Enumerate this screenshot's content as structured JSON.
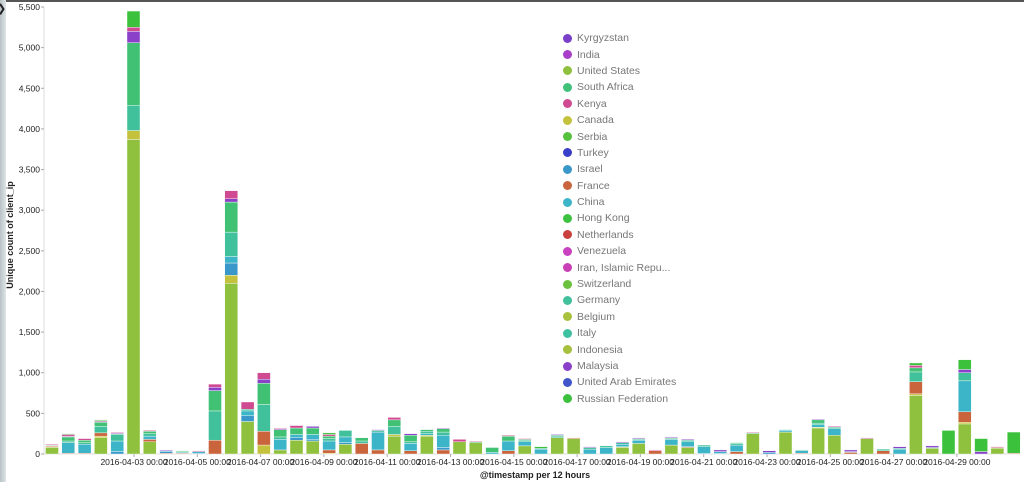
{
  "chart_data": {
    "type": "bar",
    "stacked": true,
    "xlabel": "@timestamp per 12 hours",
    "ylabel": "Unique count of client_ip",
    "ylim": [
      0,
      5500
    ],
    "yticks": [
      "0",
      "500",
      "1,000",
      "1,500",
      "2,000",
      "2,500",
      "3,000",
      "3,500",
      "4,000",
      "4,500",
      "5,000",
      "5,500"
    ],
    "xticks": [
      "2016-04-03 00:00",
      "2016-04-05 00:00",
      "2016-04-07 00:00",
      "2016-04-09 00:00",
      "2016-04-11 00:00",
      "2016-04-13 00:00",
      "2016-04-15 00:00",
      "2016-04-17 00:00",
      "2016-04-19 00:00",
      "2016-04-21 00:00",
      "2016-04-23 00:00",
      "2016-04-25 00:00",
      "2016-04-27 00:00",
      "2016-04-29 00:00"
    ],
    "x": [
      "2016-04-01 12:00",
      "2016-04-02 00:00",
      "2016-04-02 12:00",
      "2016-04-03 00:00",
      "2016-04-03 12:00",
      "2016-04-04 00:00",
      "2016-04-04 12:00",
      "2016-04-05 00:00",
      "2016-04-05 12:00",
      "2016-04-06 00:00",
      "2016-04-06 12:00",
      "2016-04-07 00:00",
      "2016-04-07 12:00",
      "2016-04-08 00:00",
      "2016-04-08 12:00",
      "2016-04-09 00:00",
      "2016-04-09 12:00",
      "2016-04-10 00:00",
      "2016-04-10 12:00",
      "2016-04-11 00:00",
      "2016-04-11 12:00",
      "2016-04-12 00:00",
      "2016-04-12 12:00",
      "2016-04-13 00:00",
      "2016-04-13 12:00",
      "2016-04-14 00:00",
      "2016-04-14 12:00",
      "2016-04-15 00:00",
      "2016-04-15 12:00",
      "2016-04-16 00:00",
      "2016-04-16 12:00",
      "2016-04-17 00:00",
      "2016-04-17 12:00",
      "2016-04-18 00:00",
      "2016-04-18 12:00",
      "2016-04-19 00:00",
      "2016-04-19 12:00",
      "2016-04-20 00:00",
      "2016-04-20 12:00",
      "2016-04-21 00:00",
      "2016-04-21 12:00",
      "2016-04-22 00:00",
      "2016-04-22 12:00",
      "2016-04-23 00:00",
      "2016-04-23 12:00",
      "2016-04-24 00:00",
      "2016-04-24 12:00",
      "2016-04-25 00:00",
      "2016-04-25 12:00",
      "2016-04-26 00:00",
      "2016-04-26 12:00",
      "2016-04-27 00:00",
      "2016-04-27 12:00",
      "2016-04-28 00:00",
      "2016-04-28 12:00",
      "2016-04-29 00:00",
      "2016-04-29 12:00",
      "2016-04-30 00:00",
      "2016-04-30 12:00",
      "2016-05-01 00:00"
    ],
    "series": [
      {
        "name": "United States",
        "color": "#8fc13e",
        "values": [
          80,
          0,
          0,
          200,
          0,
          3870,
          150,
          0,
          0,
          0,
          0,
          2100,
          400,
          0,
          50,
          170,
          160,
          0,
          120,
          0,
          0,
          220,
          0,
          220,
          0,
          150,
          140,
          0,
          0,
          100,
          0,
          200,
          190,
          0,
          0,
          80,
          130,
          0,
          110,
          80,
          0,
          0,
          0,
          250,
          0,
          270,
          0,
          320,
          230,
          0,
          190,
          0,
          0,
          720,
          70,
          0,
          370,
          0,
          70,
          0
        ]
      },
      {
        "name": "Canada",
        "color": "#c4c13d",
        "values": [
          10,
          0,
          0,
          20,
          0,
          110,
          0,
          0,
          0,
          0,
          0,
          100,
          0,
          110,
          0,
          0,
          0,
          10,
          0,
          0,
          0,
          20,
          0,
          10,
          0,
          0,
          0,
          0,
          0,
          0,
          0,
          0,
          0,
          0,
          0,
          10,
          0,
          0,
          0,
          0,
          0,
          0,
          0,
          0,
          0,
          0,
          0,
          10,
          0,
          0,
          0,
          0,
          0,
          20,
          0,
          0,
          20,
          0,
          0,
          0
        ]
      },
      {
        "name": "France",
        "color": "#c9643c",
        "values": [
          10,
          10,
          10,
          40,
          0,
          0,
          30,
          10,
          10,
          0,
          170,
          0,
          0,
          170,
          0,
          0,
          0,
          40,
          0,
          130,
          50,
          0,
          40,
          0,
          50,
          0,
          0,
          0,
          40,
          0,
          0,
          0,
          10,
          0,
          0,
          0,
          0,
          40,
          0,
          10,
          0,
          0,
          30,
          0,
          0,
          0,
          10,
          0,
          0,
          20,
          0,
          40,
          0,
          150,
          0,
          0,
          130,
          0,
          10,
          10
        ]
      },
      {
        "name": "Israel",
        "color": "#3a97c9",
        "values": [
          0,
          0,
          0,
          0,
          30,
          0,
          0,
          20,
          0,
          10,
          0,
          150,
          70,
          0,
          0,
          30,
          20,
          0,
          20,
          0,
          0,
          0,
          0,
          0,
          30,
          0,
          0,
          0,
          0,
          0,
          0,
          0,
          0,
          0,
          0,
          0,
          0,
          0,
          0,
          0,
          10,
          10,
          0,
          0,
          20,
          0,
          0,
          0,
          0,
          0,
          0,
          0,
          0,
          0,
          0,
          0,
          0,
          0,
          0,
          0
        ]
      },
      {
        "name": "China",
        "color": "#3cb5c8",
        "values": [
          0,
          130,
          110,
          0,
          130,
          0,
          40,
          10,
          10,
          20,
          0,
          80,
          60,
          0,
          130,
          40,
          60,
          110,
          70,
          0,
          220,
          0,
          90,
          20,
          150,
          0,
          0,
          20,
          120,
          50,
          60,
          0,
          0,
          60,
          80,
          30,
          40,
          0,
          70,
          60,
          80,
          20,
          80,
          0,
          0,
          20,
          30,
          30,
          80,
          10,
          0,
          0,
          60,
          0,
          0,
          0,
          380,
          0,
          0,
          0
        ]
      },
      {
        "name": "Germany",
        "color": "#41c19b",
        "values": [
          0,
          20,
          20,
          80,
          80,
          310,
          30,
          0,
          10,
          0,
          360,
          300,
          20,
          330,
          30,
          0,
          0,
          30,
          80,
          30,
          20,
          100,
          20,
          30,
          40,
          0,
          0,
          0,
          0,
          20,
          10,
          20,
          0,
          20,
          20,
          20,
          10,
          0,
          10,
          20,
          20,
          0,
          20,
          0,
          0,
          10,
          10,
          20,
          20,
          0,
          0,
          20,
          10,
          120,
          10,
          0,
          100,
          0,
          0,
          0
        ]
      },
      {
        "name": "South Africa",
        "color": "#40c173",
        "values": [
          10,
          50,
          30,
          50,
          10,
          770,
          30,
          0,
          10,
          0,
          250,
          370,
          0,
          260,
          90,
          80,
          80,
          30,
          0,
          40,
          0,
          80,
          80,
          20,
          40,
          0,
          10,
          60,
          60,
          10,
          0,
          10,
          0,
          0,
          0,
          0,
          10,
          0,
          10,
          0,
          0,
          0,
          10,
          10,
          0,
          0,
          0,
          40,
          0,
          0,
          0,
          0,
          0,
          50,
          0,
          0,
          0,
          0,
          0,
          0
        ]
      },
      {
        "name": "Malaysia",
        "color": "#8a40c9",
        "values": [
          0,
          10,
          0,
          10,
          10,
          140,
          0,
          10,
          0,
          0,
          40,
          40,
          0,
          50,
          10,
          0,
          20,
          0,
          0,
          0,
          10,
          0,
          20,
          0,
          10,
          0,
          0,
          0,
          0,
          0,
          0,
          10,
          0,
          10,
          0,
          10,
          10,
          0,
          10,
          10,
          0,
          20,
          0,
          0,
          20,
          0,
          0,
          10,
          0,
          20,
          0,
          0,
          20,
          0,
          20,
          0,
          40,
          30,
          0,
          0
        ]
      },
      {
        "name": "Kenya",
        "color": "#d04a92",
        "values": [
          10,
          20,
          20,
          10,
          10,
          50,
          10,
          0,
          0,
          10,
          40,
          100,
          90,
          80,
          10,
          30,
          0,
          20,
          0,
          0,
          0,
          30,
          0,
          0,
          0,
          30,
          10,
          0,
          10,
          10,
          0,
          0,
          0,
          0,
          0,
          0,
          0,
          10,
          0,
          0,
          0,
          0,
          0,
          10,
          0,
          0,
          0,
          0,
          10,
          0,
          10,
          0,
          0,
          30,
          0,
          0,
          0,
          0,
          10,
          0
        ]
      },
      {
        "name": "Russian Federation",
        "color": "#3cc13c",
        "values": [
          0,
          10,
          0,
          10,
          0,
          200,
          0,
          0,
          0,
          0,
          0,
          0,
          0,
          0,
          0,
          0,
          0,
          20,
          0,
          0,
          0,
          0,
          0,
          0,
          0,
          0,
          0,
          0,
          0,
          0,
          20,
          0,
          0,
          0,
          0,
          0,
          0,
          0,
          0,
          0,
          0,
          0,
          0,
          0,
          0,
          0,
          0,
          0,
          0,
          0,
          0,
          0,
          0,
          30,
          0,
          290,
          120,
          160,
          0,
          260
        ]
      }
    ],
    "legend": {
      "position": "top-right",
      "items": [
        {
          "name": "Kyrgyzstan",
          "color": "#7a3fc9"
        },
        {
          "name": "India",
          "color": "#a93fc9"
        },
        {
          "name": "United States",
          "color": "#8fc13e"
        },
        {
          "name": "South Africa",
          "color": "#40c17a"
        },
        {
          "name": "Kenya",
          "color": "#d04a92"
        },
        {
          "name": "Canada",
          "color": "#c4c13d"
        },
        {
          "name": "Serbia",
          "color": "#56c13e"
        },
        {
          "name": "Turkey",
          "color": "#3a3fc9"
        },
        {
          "name": "Israel",
          "color": "#3a97c9"
        },
        {
          "name": "France",
          "color": "#c9643c"
        },
        {
          "name": "China",
          "color": "#3cb5c8"
        },
        {
          "name": "Hong Kong",
          "color": "#3cc140"
        },
        {
          "name": "Netherlands",
          "color": "#c9403c"
        },
        {
          "name": "Venezuela",
          "color": "#c940c0"
        },
        {
          "name": "Iran, Islamic Repu...",
          "color": "#c93fb5"
        },
        {
          "name": "Switzerland",
          "color": "#6cc13e"
        },
        {
          "name": "Germany",
          "color": "#41c19b"
        },
        {
          "name": "Belgium",
          "color": "#a9c13d"
        },
        {
          "name": "Italy",
          "color": "#3dc1a0"
        },
        {
          "name": "Indonesia",
          "color": "#a5c13d"
        },
        {
          "name": "Malaysia",
          "color": "#8a40c9"
        },
        {
          "name": "United Arab Emirates",
          "color": "#3f55c9"
        },
        {
          "name": "Russian Federation",
          "color": "#3cc13c"
        }
      ]
    }
  }
}
